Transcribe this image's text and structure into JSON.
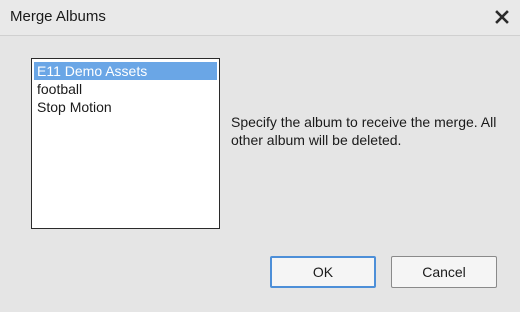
{
  "dialog": {
    "title": "Merge Albums",
    "close_icon": "close-icon"
  },
  "album_list": {
    "items": [
      {
        "label": "E11 Demo Assets",
        "selected": true
      },
      {
        "label": "football",
        "selected": false
      },
      {
        "label": "Stop Motion",
        "selected": false
      }
    ]
  },
  "message": "Specify the album to receive the merge. All other album will be deleted.",
  "buttons": {
    "ok_label": "OK",
    "cancel_label": "Cancel"
  },
  "colors": {
    "selection": "#6aa6e6",
    "default_button_border": "#4d8fd8"
  }
}
